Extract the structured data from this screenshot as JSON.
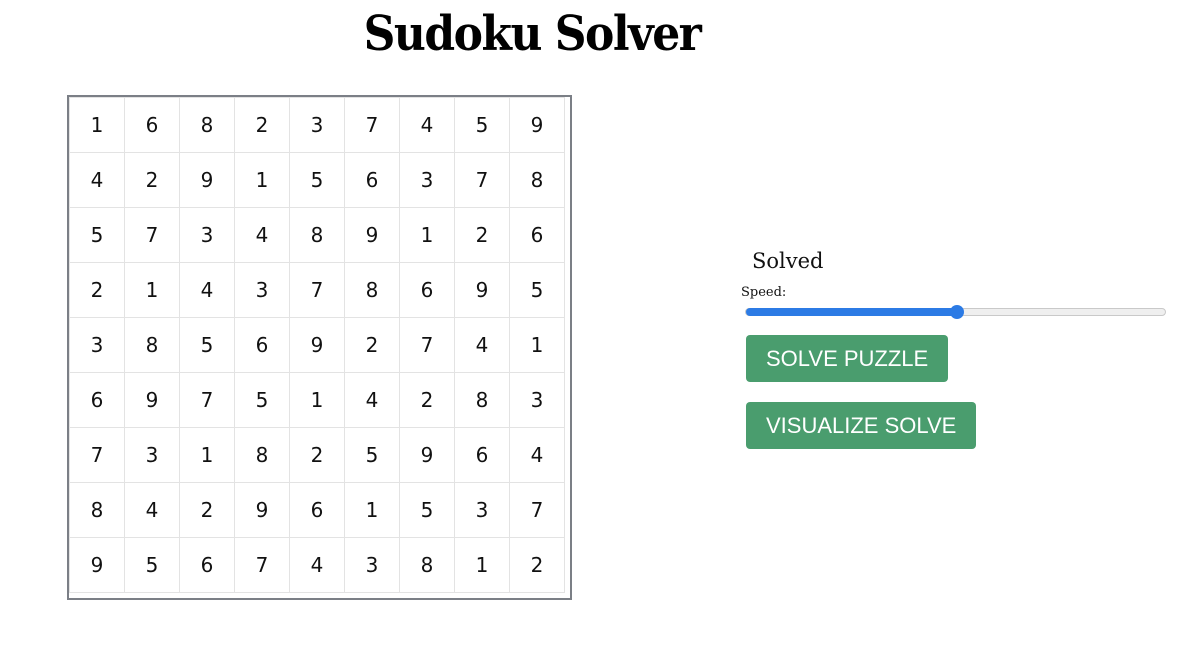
{
  "header": {
    "title": "Sudoku Solver"
  },
  "board": {
    "rows": [
      [
        "1",
        "6",
        "8",
        "2",
        "3",
        "7",
        "4",
        "5",
        "9"
      ],
      [
        "4",
        "2",
        "9",
        "1",
        "5",
        "6",
        "3",
        "7",
        "8"
      ],
      [
        "5",
        "7",
        "3",
        "4",
        "8",
        "9",
        "1",
        "2",
        "6"
      ],
      [
        "2",
        "1",
        "4",
        "3",
        "7",
        "8",
        "6",
        "9",
        "5"
      ],
      [
        "3",
        "8",
        "5",
        "6",
        "9",
        "2",
        "7",
        "4",
        "1"
      ],
      [
        "6",
        "9",
        "7",
        "5",
        "1",
        "4",
        "2",
        "8",
        "3"
      ],
      [
        "7",
        "3",
        "1",
        "8",
        "2",
        "5",
        "9",
        "6",
        "4"
      ],
      [
        "8",
        "4",
        "2",
        "9",
        "6",
        "1",
        "5",
        "3",
        "7"
      ],
      [
        "9",
        "5",
        "6",
        "7",
        "4",
        "3",
        "8",
        "1",
        "2"
      ]
    ]
  },
  "controls": {
    "status": "Solved",
    "speed_label": "Speed:",
    "speed_value": 0.5,
    "solve_label": "SOLVE PUZZLE",
    "visualize_label": "VISUALIZE SOLVE"
  },
  "colors": {
    "button": "#4a9d6e",
    "slider_accent": "#2c7be5",
    "board_border": "#7b7f86"
  }
}
